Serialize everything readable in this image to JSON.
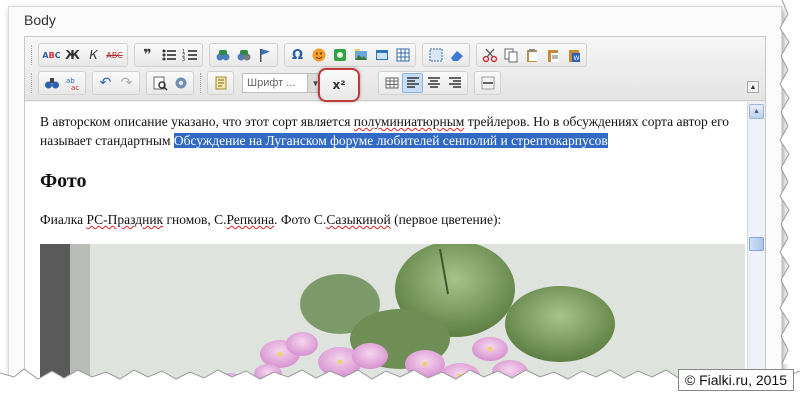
{
  "section_label": "Body",
  "toolbar": {
    "row1": {
      "text_group": [
        {
          "icon": "spellcheck-icon",
          "glyph": "ABC"
        },
        {
          "icon": "bold-icon",
          "glyph": "Ж"
        },
        {
          "icon": "italic-icon",
          "glyph": "К"
        },
        {
          "icon": "strikethrough-icon",
          "glyph": "ABC"
        }
      ]
    },
    "font_combo_label": "Шрифт ...",
    "superscript_label": "x²"
  },
  "content": {
    "para1_before": "В авторском описание указано, что этот сорт является ",
    "para1_spell": "полуминиатюрным",
    "para1_middle": " трейлеров. Но в обсуждениях сорта автор его называет стандартным ",
    "para1_link": "Обсуждение на Луганском форуме любителей сенполий и стрептокарпусов",
    "heading": "Фото",
    "para2_a": "Фиалка ",
    "para2_spell1": "РС-Праздник",
    "para2_b": " гномов, С.",
    "para2_spell2": "Репкина",
    "para2_c": ". Фото С.",
    "para2_spell3": "Сазыкиной",
    "para2_d": " (первое цветение):"
  },
  "watermark": "© Fialki.ru, 2015"
}
